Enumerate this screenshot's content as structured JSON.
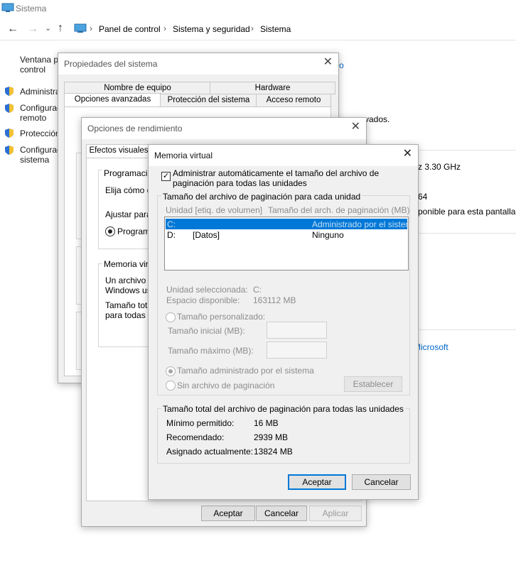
{
  "window": {
    "title": "Sistema"
  },
  "breadcrumb": [
    "Panel de control",
    "Sistema y seguridad",
    "Sistema"
  ],
  "left_nav": {
    "home_line1": "Ventana pr",
    "home_line2": "control",
    "items": [
      "Administra",
      "Configurac",
      "remoto",
      "Protección",
      "Configurac",
      "sistema"
    ]
  },
  "background_text": {
    "fragment_o": "o",
    "vados": "vados.",
    "cpu_speed": "z  3.30 GHz",
    "arch": "64",
    "screen": "ponible para esta pantalla",
    "microsoft": "Microsoft"
  },
  "props_dialog": {
    "title": "Propiedades del sistema",
    "tabs_row1": [
      "Nombre de equipo",
      "Hardware"
    ],
    "tabs_row2": [
      "Opciones avanzadas",
      "Protección del sistema",
      "Acceso remoto"
    ]
  },
  "perf_dialog": {
    "title": "Opciones de rendimiento",
    "tab_visual": "Efectos visuales",
    "group_sched": "Programació",
    "choose": "Elija cómo d",
    "adjust": "Ajustar para",
    "programs": "Programa",
    "group_vm": "Memoria virt",
    "vm_text1": "Un archivo d",
    "vm_text2": "Windows us",
    "vm_text3": "Tamaño total",
    "vm_text4": "para todas la",
    "ok": "Aceptar",
    "cancel": "Cancelar",
    "apply": "Aplicar"
  },
  "vm_dialog": {
    "title": "Memoria virtual",
    "auto_manage_line1": "Administrar automáticamente el tamaño del archivo de",
    "auto_manage_line2": "paginación para todas las unidades",
    "auto_manage_checked": true,
    "group_title": "Tamaño del archivo de paginación para cada unidad",
    "columns": [
      "Unidad [etiq. de volumen]",
      "Tamaño del arch. de paginación (MB)"
    ],
    "drives": [
      {
        "drive": "C:",
        "label": "",
        "size": "Administrado por el sistema",
        "selected": true
      },
      {
        "drive": "D:",
        "label": "[Datos]",
        "size": "Ninguno",
        "selected": false
      }
    ],
    "selected_drive_label": "Unidad seleccionada:",
    "selected_drive_value": "C:",
    "available_label": "Espacio disponible:",
    "available_value": "163112 MB",
    "custom_size": "Tamaño personalizado:",
    "initial_size": "Tamaño inicial (MB):",
    "max_size": "Tamaño máximo (MB):",
    "system_managed": "Tamaño administrado por el sistema",
    "no_paging": "Sin archivo de paginación",
    "set_button": "Establecer",
    "totals_title": "Tamaño total del archivo de paginación para todas las unidades",
    "min_label": "Mínimo permitido:",
    "min_value": "16 MB",
    "rec_label": "Recomendado:",
    "rec_value": "2939 MB",
    "cur_label": "Asignado actualmente:",
    "cur_value": "13824 MB",
    "ok": "Aceptar",
    "cancel": "Cancelar"
  },
  "colors": {
    "accent": "#0078d7",
    "link": "#0066cc",
    "selection": "#0078d7"
  }
}
